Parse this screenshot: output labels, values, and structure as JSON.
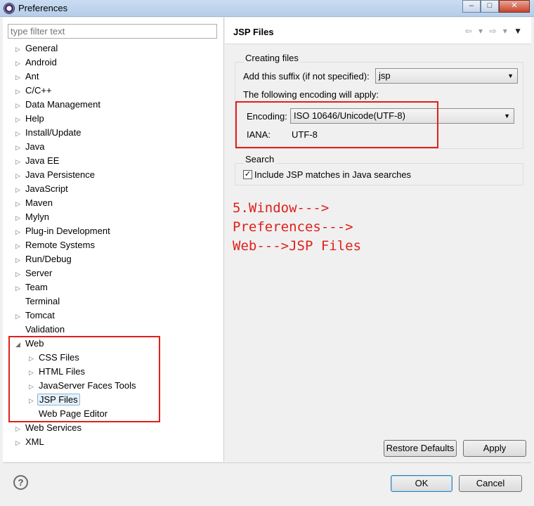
{
  "window": {
    "title": "Preferences",
    "controls": [
      "–",
      "□",
      "✕"
    ]
  },
  "filter": {
    "placeholder": "type filter text"
  },
  "tree": [
    {
      "label": "General",
      "arrow": "▷",
      "level": 0
    },
    {
      "label": "Android",
      "arrow": "▷",
      "level": 0
    },
    {
      "label": "Ant",
      "arrow": "▷",
      "level": 0
    },
    {
      "label": "C/C++",
      "arrow": "▷",
      "level": 0
    },
    {
      "label": "Data Management",
      "arrow": "▷",
      "level": 0
    },
    {
      "label": "Help",
      "arrow": "▷",
      "level": 0
    },
    {
      "label": "Install/Update",
      "arrow": "▷",
      "level": 0
    },
    {
      "label": "Java",
      "arrow": "▷",
      "level": 0
    },
    {
      "label": "Java EE",
      "arrow": "▷",
      "level": 0
    },
    {
      "label": "Java Persistence",
      "arrow": "▷",
      "level": 0
    },
    {
      "label": "JavaScript",
      "arrow": "▷",
      "level": 0
    },
    {
      "label": "Maven",
      "arrow": "▷",
      "level": 0
    },
    {
      "label": "Mylyn",
      "arrow": "▷",
      "level": 0
    },
    {
      "label": "Plug-in Development",
      "arrow": "▷",
      "level": 0
    },
    {
      "label": "Remote Systems",
      "arrow": "▷",
      "level": 0
    },
    {
      "label": "Run/Debug",
      "arrow": "▷",
      "level": 0
    },
    {
      "label": "Server",
      "arrow": "▷",
      "level": 0
    },
    {
      "label": "Team",
      "arrow": "▷",
      "level": 0
    },
    {
      "label": "Terminal",
      "arrow": "",
      "level": 0
    },
    {
      "label": "Tomcat",
      "arrow": "▷",
      "level": 0
    },
    {
      "label": "Validation",
      "arrow": "",
      "level": 0
    },
    {
      "label": "Web",
      "arrow": "◢",
      "level": 0
    },
    {
      "label": "CSS Files",
      "arrow": "▷",
      "level": 1
    },
    {
      "label": "HTML Files",
      "arrow": "▷",
      "level": 1
    },
    {
      "label": "JavaServer Faces Tools",
      "arrow": "▷",
      "level": 1
    },
    {
      "label": "JSP Files",
      "arrow": "▷",
      "level": 1,
      "selected": true
    },
    {
      "label": "Web Page Editor",
      "arrow": "",
      "level": 1
    },
    {
      "label": "Web Services",
      "arrow": "▷",
      "level": 0
    },
    {
      "label": "XML",
      "arrow": "▷",
      "level": 0
    }
  ],
  "page": {
    "title": "JSP Files",
    "nav_icons": "⇦ ▾ ⇨ ▾",
    "nav_menu": "▼",
    "creating": {
      "label": "Creating files",
      "suffix_label": "Add this suffix (if not specified):",
      "suffix_value": "jsp",
      "encoding_note": "The following encoding will apply:",
      "encoding_label": "Encoding:",
      "encoding_value": "ISO 10646/Unicode(UTF-8)",
      "iana_label": "IANA:",
      "iana_value": "UTF-8"
    },
    "search": {
      "label": "Search",
      "checkbox_label": "Include JSP matches in Java searches",
      "checked": true,
      "check_mark": "✓"
    },
    "annotation": "5.Window--->\nPreferences--->\nWeb--->JSP Files",
    "restore_defaults": "Restore Defaults",
    "apply": "Apply"
  },
  "footer": {
    "help": "?",
    "ok": "OK",
    "cancel": "Cancel"
  },
  "colors": {
    "highlight_red": "#e0201a",
    "selection": "#e5f1fb"
  }
}
